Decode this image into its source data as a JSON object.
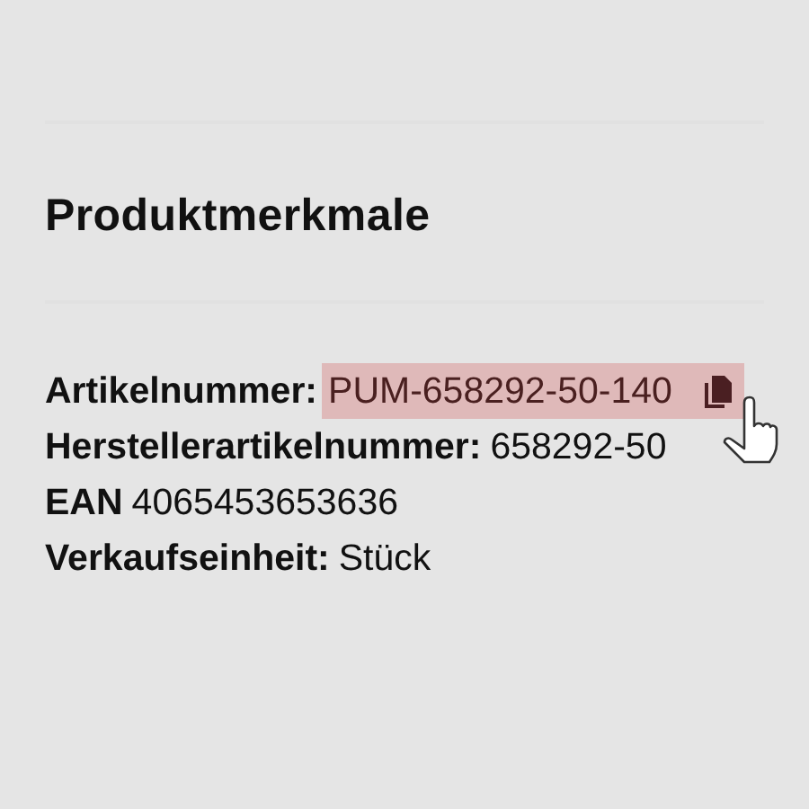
{
  "heading": "Produktmerkmale",
  "properties": [
    {
      "label": "Artikelnummer:",
      "value": "PUM-658292-50-140",
      "highlighted": true
    },
    {
      "label": "Herstellerartikelnummer:",
      "value": "658292-50",
      "highlighted": false
    },
    {
      "label": "EAN",
      "value": "4065453653636",
      "highlighted": false
    },
    {
      "label": "Verkaufseinheit:",
      "value": "Stück",
      "highlighted": false
    }
  ]
}
